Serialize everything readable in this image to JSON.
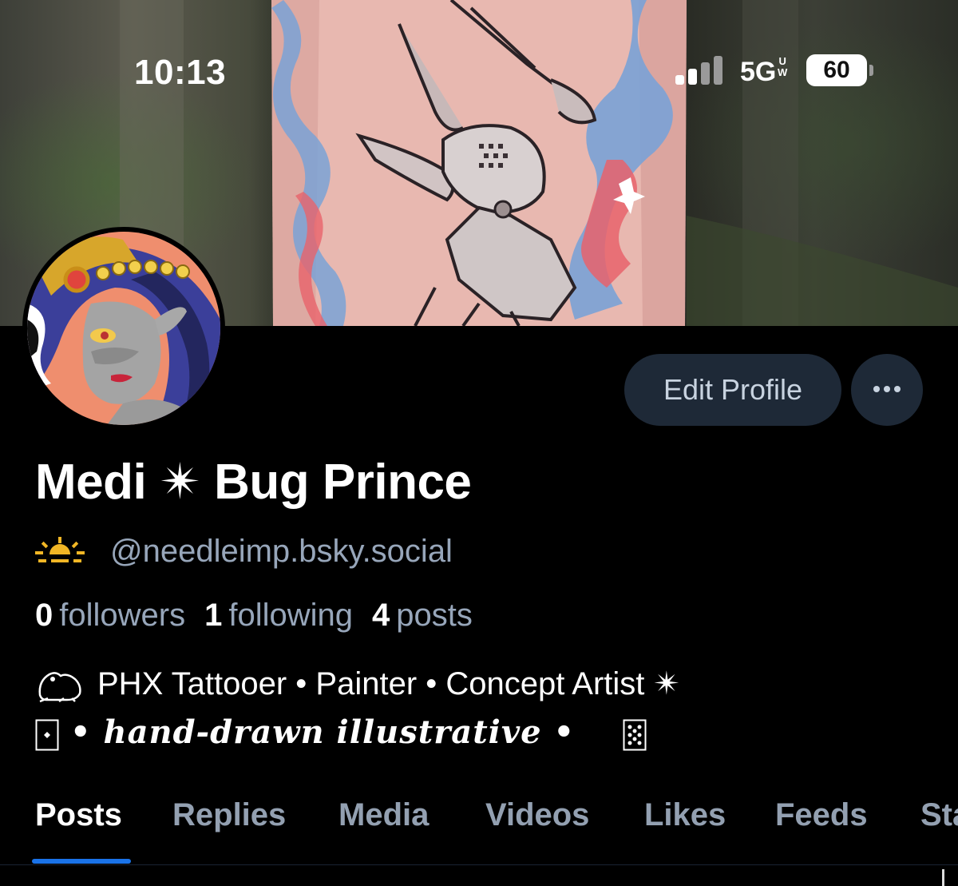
{
  "status_bar": {
    "time": "10:13",
    "network": "5G",
    "network_sub_top": "U",
    "network_sub_bottom": "W",
    "battery": "60"
  },
  "profile": {
    "display_name": "Medi ✴ Bug Prince",
    "handle": "@needleimp.bsky.social",
    "stats": [
      {
        "count": "0",
        "label": "followers"
      },
      {
        "count": "1",
        "label": "following"
      },
      {
        "count": "4",
        "label": "posts"
      }
    ],
    "bio_line1": "PHX Tattooer • Painter • Concept Artist ✴",
    "bio_line2": "• hand-drawn illustrative •"
  },
  "actions": {
    "edit_profile_label": "Edit Profile",
    "more_icon": "ellipsis-icon"
  },
  "tabs": [
    {
      "label": "Posts",
      "active": true
    },
    {
      "label": "Replies",
      "active": false
    },
    {
      "label": "Media",
      "active": false
    },
    {
      "label": "Videos",
      "active": false
    },
    {
      "label": "Likes",
      "active": false
    },
    {
      "label": "Feeds",
      "active": false
    },
    {
      "label": "Sta",
      "active": false
    }
  ],
  "colors": {
    "background": "#000000",
    "button_bg": "#1e2937",
    "muted_text": "#97a6ba",
    "accent": "#1a73e8"
  }
}
